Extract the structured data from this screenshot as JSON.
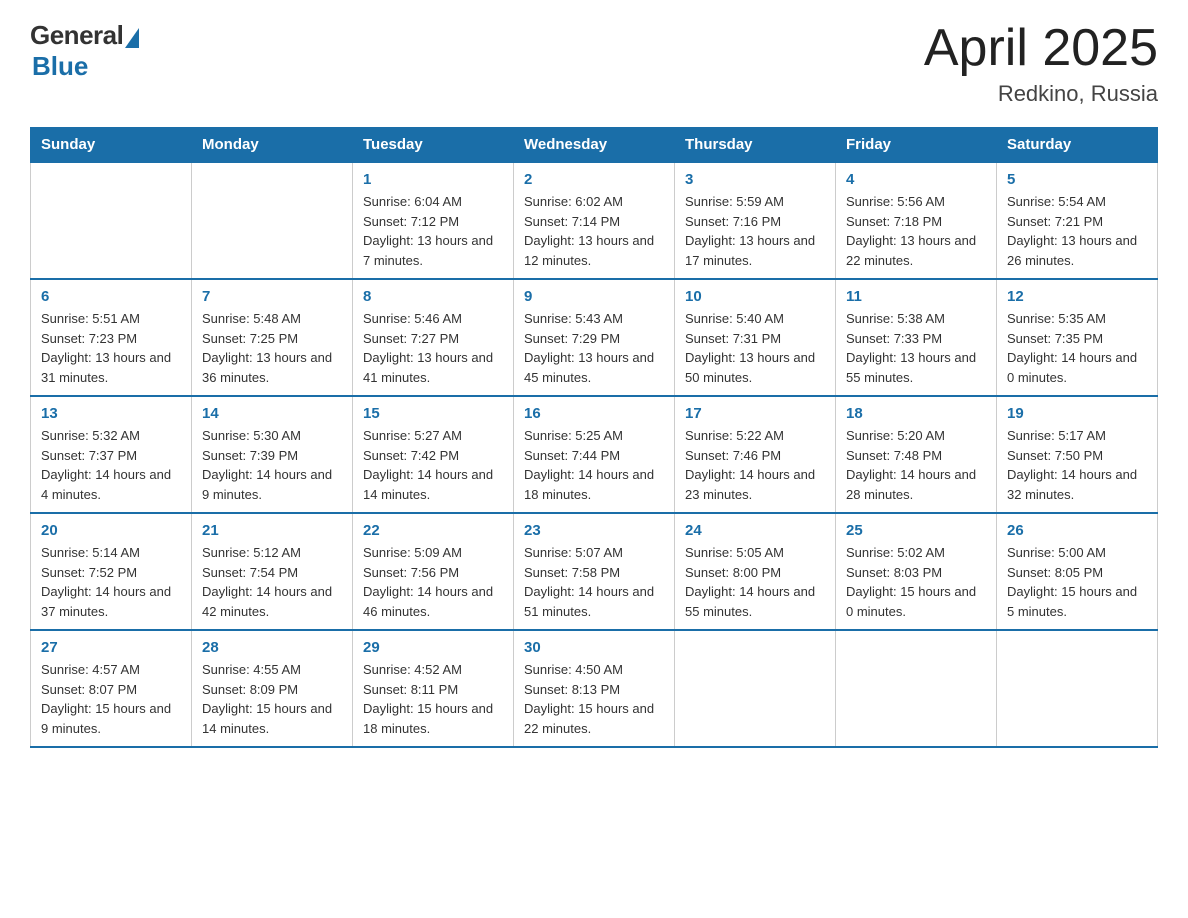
{
  "logo": {
    "general": "General",
    "blue": "Blue"
  },
  "title": {
    "month_year": "April 2025",
    "location": "Redkino, Russia"
  },
  "weekdays": [
    "Sunday",
    "Monday",
    "Tuesday",
    "Wednesday",
    "Thursday",
    "Friday",
    "Saturday"
  ],
  "weeks": [
    [
      {
        "day": "",
        "sunrise": "",
        "sunset": "",
        "daylight": ""
      },
      {
        "day": "",
        "sunrise": "",
        "sunset": "",
        "daylight": ""
      },
      {
        "day": "1",
        "sunrise": "Sunrise: 6:04 AM",
        "sunset": "Sunset: 7:12 PM",
        "daylight": "Daylight: 13 hours and 7 minutes."
      },
      {
        "day": "2",
        "sunrise": "Sunrise: 6:02 AM",
        "sunset": "Sunset: 7:14 PM",
        "daylight": "Daylight: 13 hours and 12 minutes."
      },
      {
        "day": "3",
        "sunrise": "Sunrise: 5:59 AM",
        "sunset": "Sunset: 7:16 PM",
        "daylight": "Daylight: 13 hours and 17 minutes."
      },
      {
        "day": "4",
        "sunrise": "Sunrise: 5:56 AM",
        "sunset": "Sunset: 7:18 PM",
        "daylight": "Daylight: 13 hours and 22 minutes."
      },
      {
        "day": "5",
        "sunrise": "Sunrise: 5:54 AM",
        "sunset": "Sunset: 7:21 PM",
        "daylight": "Daylight: 13 hours and 26 minutes."
      }
    ],
    [
      {
        "day": "6",
        "sunrise": "Sunrise: 5:51 AM",
        "sunset": "Sunset: 7:23 PM",
        "daylight": "Daylight: 13 hours and 31 minutes."
      },
      {
        "day": "7",
        "sunrise": "Sunrise: 5:48 AM",
        "sunset": "Sunset: 7:25 PM",
        "daylight": "Daylight: 13 hours and 36 minutes."
      },
      {
        "day": "8",
        "sunrise": "Sunrise: 5:46 AM",
        "sunset": "Sunset: 7:27 PM",
        "daylight": "Daylight: 13 hours and 41 minutes."
      },
      {
        "day": "9",
        "sunrise": "Sunrise: 5:43 AM",
        "sunset": "Sunset: 7:29 PM",
        "daylight": "Daylight: 13 hours and 45 minutes."
      },
      {
        "day": "10",
        "sunrise": "Sunrise: 5:40 AM",
        "sunset": "Sunset: 7:31 PM",
        "daylight": "Daylight: 13 hours and 50 minutes."
      },
      {
        "day": "11",
        "sunrise": "Sunrise: 5:38 AM",
        "sunset": "Sunset: 7:33 PM",
        "daylight": "Daylight: 13 hours and 55 minutes."
      },
      {
        "day": "12",
        "sunrise": "Sunrise: 5:35 AM",
        "sunset": "Sunset: 7:35 PM",
        "daylight": "Daylight: 14 hours and 0 minutes."
      }
    ],
    [
      {
        "day": "13",
        "sunrise": "Sunrise: 5:32 AM",
        "sunset": "Sunset: 7:37 PM",
        "daylight": "Daylight: 14 hours and 4 minutes."
      },
      {
        "day": "14",
        "sunrise": "Sunrise: 5:30 AM",
        "sunset": "Sunset: 7:39 PM",
        "daylight": "Daylight: 14 hours and 9 minutes."
      },
      {
        "day": "15",
        "sunrise": "Sunrise: 5:27 AM",
        "sunset": "Sunset: 7:42 PM",
        "daylight": "Daylight: 14 hours and 14 minutes."
      },
      {
        "day": "16",
        "sunrise": "Sunrise: 5:25 AM",
        "sunset": "Sunset: 7:44 PM",
        "daylight": "Daylight: 14 hours and 18 minutes."
      },
      {
        "day": "17",
        "sunrise": "Sunrise: 5:22 AM",
        "sunset": "Sunset: 7:46 PM",
        "daylight": "Daylight: 14 hours and 23 minutes."
      },
      {
        "day": "18",
        "sunrise": "Sunrise: 5:20 AM",
        "sunset": "Sunset: 7:48 PM",
        "daylight": "Daylight: 14 hours and 28 minutes."
      },
      {
        "day": "19",
        "sunrise": "Sunrise: 5:17 AM",
        "sunset": "Sunset: 7:50 PM",
        "daylight": "Daylight: 14 hours and 32 minutes."
      }
    ],
    [
      {
        "day": "20",
        "sunrise": "Sunrise: 5:14 AM",
        "sunset": "Sunset: 7:52 PM",
        "daylight": "Daylight: 14 hours and 37 minutes."
      },
      {
        "day": "21",
        "sunrise": "Sunrise: 5:12 AM",
        "sunset": "Sunset: 7:54 PM",
        "daylight": "Daylight: 14 hours and 42 minutes."
      },
      {
        "day": "22",
        "sunrise": "Sunrise: 5:09 AM",
        "sunset": "Sunset: 7:56 PM",
        "daylight": "Daylight: 14 hours and 46 minutes."
      },
      {
        "day": "23",
        "sunrise": "Sunrise: 5:07 AM",
        "sunset": "Sunset: 7:58 PM",
        "daylight": "Daylight: 14 hours and 51 minutes."
      },
      {
        "day": "24",
        "sunrise": "Sunrise: 5:05 AM",
        "sunset": "Sunset: 8:00 PM",
        "daylight": "Daylight: 14 hours and 55 minutes."
      },
      {
        "day": "25",
        "sunrise": "Sunrise: 5:02 AM",
        "sunset": "Sunset: 8:03 PM",
        "daylight": "Daylight: 15 hours and 0 minutes."
      },
      {
        "day": "26",
        "sunrise": "Sunrise: 5:00 AM",
        "sunset": "Sunset: 8:05 PM",
        "daylight": "Daylight: 15 hours and 5 minutes."
      }
    ],
    [
      {
        "day": "27",
        "sunrise": "Sunrise: 4:57 AM",
        "sunset": "Sunset: 8:07 PM",
        "daylight": "Daylight: 15 hours and 9 minutes."
      },
      {
        "day": "28",
        "sunrise": "Sunrise: 4:55 AM",
        "sunset": "Sunset: 8:09 PM",
        "daylight": "Daylight: 15 hours and 14 minutes."
      },
      {
        "day": "29",
        "sunrise": "Sunrise: 4:52 AM",
        "sunset": "Sunset: 8:11 PM",
        "daylight": "Daylight: 15 hours and 18 minutes."
      },
      {
        "day": "30",
        "sunrise": "Sunrise: 4:50 AM",
        "sunset": "Sunset: 8:13 PM",
        "daylight": "Daylight: 15 hours and 22 minutes."
      },
      {
        "day": "",
        "sunrise": "",
        "sunset": "",
        "daylight": ""
      },
      {
        "day": "",
        "sunrise": "",
        "sunset": "",
        "daylight": ""
      },
      {
        "day": "",
        "sunrise": "",
        "sunset": "",
        "daylight": ""
      }
    ]
  ]
}
